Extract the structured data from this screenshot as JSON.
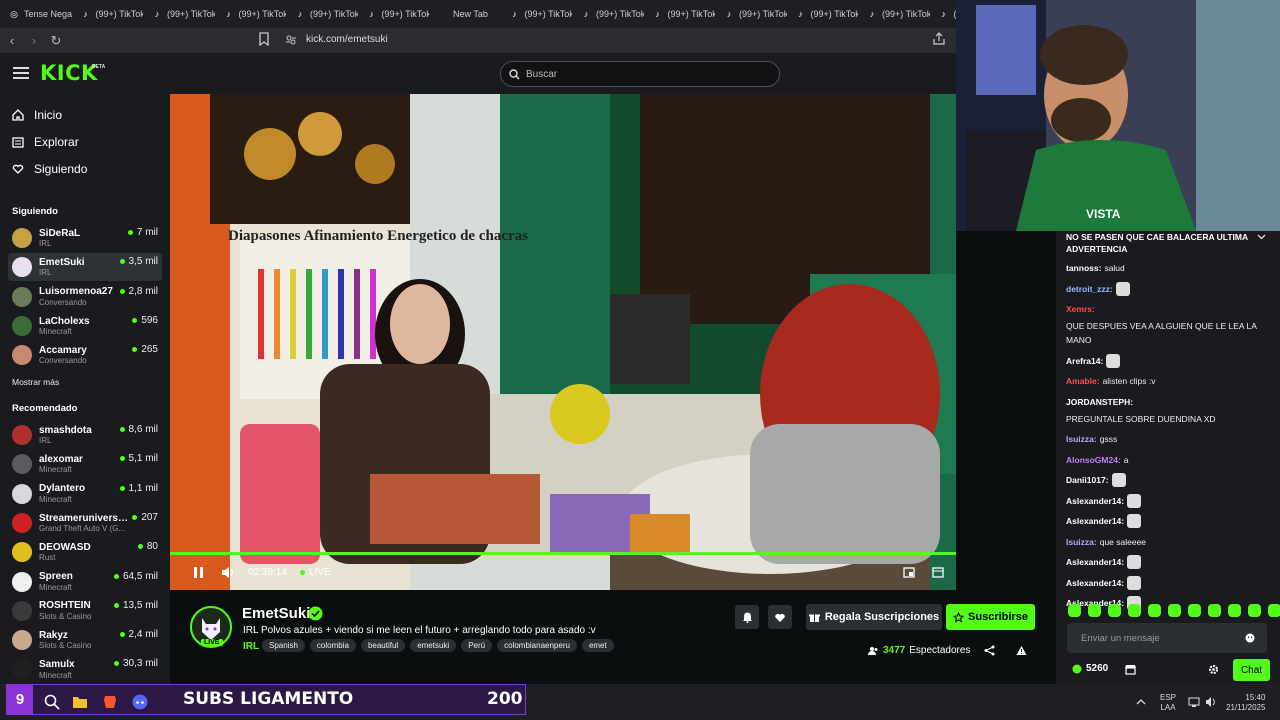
{
  "browser": {
    "tabs": [
      {
        "label": "Tense Nega",
        "icon": "globe-icon"
      },
      {
        "label": "(99+) TikTok",
        "icon": "tiktok-icon"
      },
      {
        "label": "(99+) TikTok",
        "icon": "tiktok-icon"
      },
      {
        "label": "(99+) TikTok",
        "icon": "tiktok-icon"
      },
      {
        "label": "(99+) TikTok",
        "icon": "tiktok-icon"
      },
      {
        "label": "(99+) TikTok",
        "icon": "tiktok-icon"
      },
      {
        "label": "New Tab",
        "icon": "blank-tab-icon"
      },
      {
        "label": "(99+) TikTok",
        "icon": "tiktok-icon"
      },
      {
        "label": "(99+) TikTok",
        "icon": "tiktok-icon"
      },
      {
        "label": "(99+) TikTok",
        "icon": "tiktok-icon"
      },
      {
        "label": "(99+) TikTok",
        "icon": "tiktok-icon"
      },
      {
        "label": "(99+) TikTok",
        "icon": "tiktok-icon"
      },
      {
        "label": "(99+) TikTok",
        "icon": "tiktok-icon"
      },
      {
        "label": "(99+) TikTok",
        "icon": "tiktok-icon"
      }
    ],
    "url": "kick.com/emetsuki"
  },
  "header": {
    "logo": "KICK",
    "beta": "BETA",
    "search_placeholder": "Buscar"
  },
  "sidebar": {
    "nav": [
      {
        "label": "Inicio",
        "icon": "home-icon"
      },
      {
        "label": "Explorar",
        "icon": "browse-icon"
      },
      {
        "label": "Siguiendo",
        "icon": "heart-icon"
      }
    ],
    "following_title": "Siguiendo",
    "following": [
      {
        "name": "SiDeRaL",
        "category": "IRL",
        "viewers": "7 mil",
        "color": "#c8a040"
      },
      {
        "name": "EmetSuki",
        "category": "IRL",
        "viewers": "3,5 mil",
        "color": "#e8e0f0"
      },
      {
        "name": "Luisormenoa27",
        "category": "Conversando",
        "viewers": "2,8 mil",
        "color": "#6b7a5a"
      },
      {
        "name": "LaCholexs",
        "category": "Minecraft",
        "viewers": "596",
        "color": "#3d6b3a"
      },
      {
        "name": "Accamary",
        "category": "Conversando",
        "viewers": "265",
        "color": "#c88870"
      }
    ],
    "show_more": "Mostrar más",
    "recommended_title": "Recomendado",
    "recommended": [
      {
        "name": "smashdota",
        "category": "IRL",
        "viewers": "8,6 mil",
        "color": "#b03030"
      },
      {
        "name": "alexomar",
        "category": "Minecraft",
        "viewers": "5,1 mil",
        "color": "#5a5a5a"
      },
      {
        "name": "Dylantero",
        "category": "Minecraft",
        "viewers": "1,1 mil",
        "color": "#d8d8d8"
      },
      {
        "name": "Streameruniversit...",
        "category": "Grand Theft Auto V (G...",
        "viewers": "207",
        "color": "#d02020"
      },
      {
        "name": "DEOWASD",
        "category": "Rust",
        "viewers": "80",
        "color": "#e0c020"
      },
      {
        "name": "Spreen",
        "category": "Minecraft",
        "viewers": "64,5 mil",
        "color": "#f0f0f0"
      },
      {
        "name": "ROSHTEIN",
        "category": "Slots & Casino",
        "viewers": "13,5 mil",
        "color": "#3a3a3a"
      },
      {
        "name": "Rakyz",
        "category": "Slots & Casino",
        "viewers": "2,4 mil",
        "color": "#c8a890"
      },
      {
        "name": "Samulx",
        "category": "Minecraft",
        "viewers": "30,3 mil",
        "color": "#202020"
      }
    ]
  },
  "player": {
    "time": "02:39:14",
    "live_label": "LIVE",
    "overlay_text": "Diapasones Afinamiento Energetico de chacras",
    "progress": 1.0
  },
  "channel": {
    "name": "EmetSuki",
    "live_badge": "LIVE",
    "title": "IRL Polvos azules + viendo si me leen el futuro + arreglando todo para asado :v",
    "category": "IRL",
    "tags": [
      "Spanish",
      "colombia",
      "beautiful",
      "emetsuki",
      "Perú",
      "colombianaenperu",
      "emet"
    ],
    "gift_label": "Regala Suscripciones",
    "subscribe_label": "Suscribirse",
    "viewers_count": "3477",
    "viewers_label": "Espectadores"
  },
  "chat": {
    "pinned": "NO SE PASEN QUE CAE BALACERA ULTIMA ADVERTENCIA",
    "messages": [
      {
        "user": "tannoss",
        "color": "#ffffff",
        "text": "salud",
        "emote": false
      },
      {
        "user": "detroit_zzz",
        "color": "#9ab8ff",
        "text": "",
        "emote": true
      },
      {
        "user": "Xemrs",
        "color": "#ff4d4d",
        "text": "QUE DESPUES VEA A ALGUIEN QUE LE LEA LA MANO",
        "emote": false
      },
      {
        "user": "Arefra14",
        "color": "#ffffff",
        "text": "",
        "emote": true
      },
      {
        "user": "Amable",
        "color": "#ff5050",
        "text": "alisten clips :v",
        "emote": false
      },
      {
        "user": "JORDANSTEPH",
        "color": "#ffffff",
        "text": "PREGUNTALE SOBRE DUENDINA XD",
        "emote": false
      },
      {
        "user": "Isuizza",
        "color": "#b9a7ff",
        "text": "gsss",
        "emote": false
      },
      {
        "user": "AlonsoGM24",
        "color": "#c77dff",
        "text": "a",
        "emote": false
      },
      {
        "user": "Danii1017",
        "color": "#ffffff",
        "text": "",
        "emote": true
      },
      {
        "user": "Aslexander14",
        "color": "#ffffff",
        "text": "",
        "emote": true
      },
      {
        "user": "Aslexander14",
        "color": "#ffffff",
        "text": "",
        "emote": true
      },
      {
        "user": "Isuizza",
        "color": "#b9a7ff",
        "text": "que saleeee",
        "emote": false
      },
      {
        "user": "Aslexander14",
        "color": "#ffffff",
        "text": "",
        "emote": true
      },
      {
        "user": "Aslexander14",
        "color": "#ffffff",
        "text": "",
        "emote": true
      },
      {
        "user": "Aslexander14",
        "color": "#ffffff",
        "text": "",
        "emote": true
      }
    ],
    "input_placeholder": "Enviar un mensaje",
    "points": "5260",
    "send_label": "Chat"
  },
  "overlay": {
    "subs_number": "9",
    "subs_label": "SUBS LIGAMENTO",
    "subs_count": "200"
  },
  "tray": {
    "lang1": "ESP",
    "lang2": "LAA",
    "time": "15:40",
    "date": "21/11/2025"
  },
  "colors": {
    "accent": "#53fc18",
    "background": "#0b0e0f",
    "panel": "#191b1f"
  }
}
